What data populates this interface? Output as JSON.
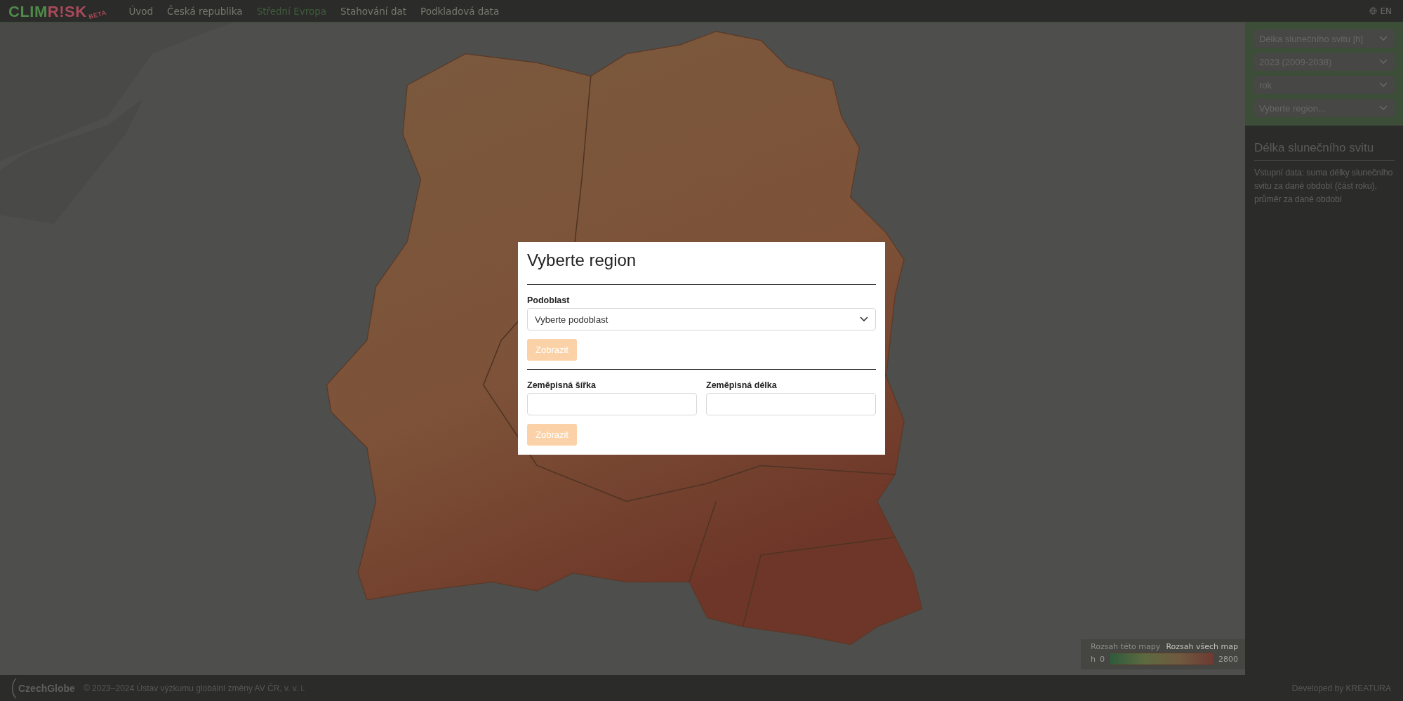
{
  "header": {
    "logo": {
      "part_1": "CLIM",
      "part_2": "R!SK",
      "badge": "BETA"
    },
    "nav": [
      {
        "label": "Úvod",
        "selected": false
      },
      {
        "label": "Česká republika",
        "selected": false
      },
      {
        "label": "Střední Evropa",
        "selected": true
      },
      {
        "label": "Stahování dat",
        "selected": false
      },
      {
        "label": "Podkladová data",
        "selected": false
      }
    ],
    "language": "EN"
  },
  "map": {
    "legend": {
      "toggles": [
        {
          "label": "Rozsah této mapy",
          "selected": false
        },
        {
          "label": "Rozsah všech map",
          "selected": true
        }
      ],
      "unit": "h",
      "min": "0",
      "max": "2800"
    }
  },
  "sidebar": {
    "selects": [
      "Délka slunečního svitu [h]",
      "2023 (2009-2038)",
      "rok",
      "Vyberte region..."
    ],
    "info_title": "Délka slunečního svitu",
    "info_text": "Vstupní data: suma délky slunečního svitu za dané období (část roku), průměr za dané období"
  },
  "modal": {
    "title": "Vyberte region",
    "subregion": {
      "label": "Podoblast",
      "placeholder": "Vyberte podoblast",
      "button": {
        "label": "Zobrazit",
        "disabled": true
      }
    },
    "coordinates": {
      "fields": [
        {
          "label": "Zeměpisná šířka"
        },
        {
          "label": "Zeměpisná délka"
        }
      ],
      "button": {
        "label": "Zobrazit",
        "disabled": true
      }
    }
  },
  "footer": {
    "logo": "CzechGlobe",
    "copyright": "© 2023–2024 Ústav výzkumu globální změny AV ČR, v. v. i.",
    "credit": "Developed by KREATURA"
  }
}
